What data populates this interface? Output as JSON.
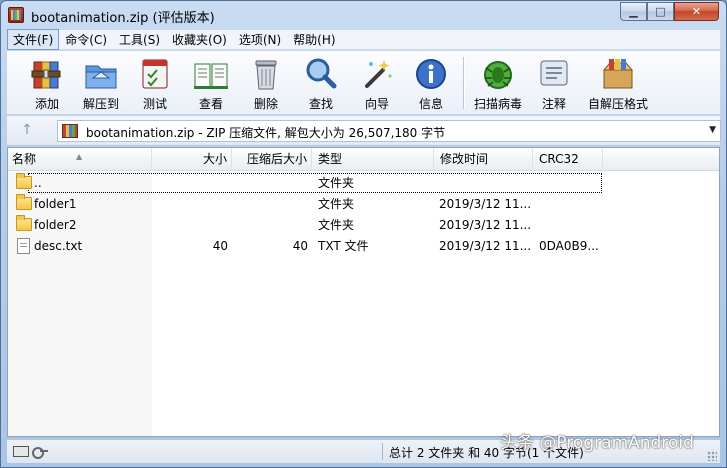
{
  "window": {
    "title": "bootanimation.zip (评估版本)",
    "caption": {
      "minimize": "▁",
      "maximize": "□",
      "close": "✕"
    }
  },
  "menu": [
    "文件(F)",
    "命令(C)",
    "工具(S)",
    "收藏夹(O)",
    "选项(N)",
    "帮助(H)"
  ],
  "toolbar": [
    {
      "label": "添加",
      "icon": "add-archive-icon"
    },
    {
      "label": "解压到",
      "icon": "extract-to-icon"
    },
    {
      "label": "测试",
      "icon": "test-icon"
    },
    {
      "label": "查看",
      "icon": "view-book-icon"
    },
    {
      "label": "删除",
      "icon": "delete-trash-icon"
    },
    {
      "label": "查找",
      "icon": "find-magnifier-icon"
    },
    {
      "label": "向导",
      "icon": "wizard-wand-icon"
    },
    {
      "label": "信息",
      "icon": "info-icon"
    },
    {
      "label": "扫描病毒",
      "icon": "virus-scan-icon"
    },
    {
      "label": "注释",
      "icon": "comment-icon"
    },
    {
      "label": "自解压格式",
      "icon": "sfx-box-icon"
    }
  ],
  "address": {
    "text": "bootanimation.zip - ZIP 压缩文件, 解包大小为 26,507,180 字节"
  },
  "columns": {
    "name": "名称",
    "size": "大小",
    "packed": "压缩后大小",
    "type": "类型",
    "modified": "修改时间",
    "crc": "CRC32"
  },
  "rows": [
    {
      "name": "..",
      "size": "",
      "packed": "",
      "type": "文件夹",
      "modified": "",
      "crc": "",
      "icon": "folder-icon"
    },
    {
      "name": "folder1",
      "size": "",
      "packed": "",
      "type": "文件夹",
      "modified": "2019/3/12 11...",
      "crc": "",
      "icon": "folder-icon"
    },
    {
      "name": "folder2",
      "size": "",
      "packed": "",
      "type": "文件夹",
      "modified": "2019/3/12 11...",
      "crc": "",
      "icon": "folder-icon"
    },
    {
      "name": "desc.txt",
      "size": "40",
      "packed": "40",
      "type": "TXT 文件",
      "modified": "2019/3/12 11...",
      "crc": "0DA0B9...",
      "icon": "text-file-icon"
    }
  ],
  "status": {
    "text": "总计 2 文件夹 和 40 字节(1 个文件)"
  },
  "watermark": "头条 @ProgramAndroid",
  "colors": {
    "titlebar": "#b6cde9",
    "close_button": "#c1462a",
    "list_background": "#ffffff",
    "name_column_shade": "#f7f7f7"
  }
}
